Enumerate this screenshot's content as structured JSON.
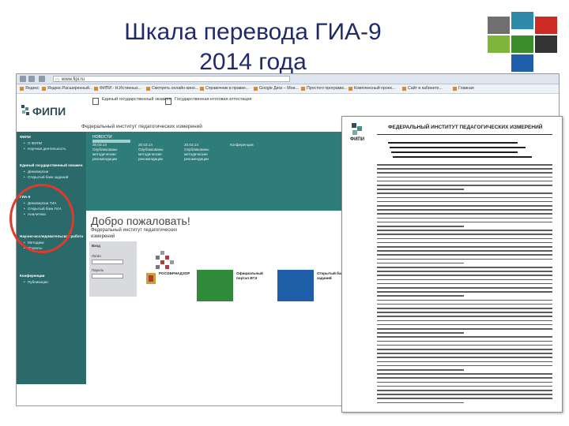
{
  "slide": {
    "title_line1": "Шкала перевода ГИА-9",
    "title_line2": "2014 года"
  },
  "browser": {
    "url": "www.fipi.ru",
    "bookmarks": [
      "Яндекс",
      "Яндекс.Расширенный...",
      "ФИПИ - Н.Истинных...",
      "Смотреть онлайн-кино...",
      "Справочник в правке...",
      "Google Диск – Мои...",
      "Простого программ...",
      "Комплексный проек...",
      "Сайт в кабинете...",
      "Главная"
    ]
  },
  "site": {
    "logo": "ФИПИ",
    "subtitle": "Федеральный институт педагогических измерений",
    "header_link1": "Единый государственный экзамен",
    "header_link2": "Государственная итоговая аттестация",
    "welcome": "Добро пожаловать!",
    "welcome_sub": "Федеральный институт педагогических измерений",
    "news_tab": "НОВОСТИ",
    "news": [
      {
        "date": "20.03.14",
        "text": "Опубликованы методические рекомендации"
      },
      {
        "date": "20.03.14",
        "text": "Опубликованы методические рекомендации"
      },
      {
        "date": "20.03.14",
        "text": "Опубликованы методические рекомендации"
      },
      {
        "date": "",
        "text": "Конференции"
      }
    ],
    "login_label": "Вход",
    "login_field1": "Логин",
    "login_field2": "Пароль",
    "cards": [
      {
        "label": "РОСОБРНАДЗОР"
      },
      {
        "label": "Официальный портал ЕГЭ"
      },
      {
        "label": "Открытый банк заданий"
      }
    ]
  },
  "leftnav": {
    "items": [
      {
        "text": "ФИПИ",
        "head": true
      },
      {
        "text": "О ФИПИ",
        "head": false
      },
      {
        "text": "Научная деятельность",
        "head": false
      },
      {
        "text": "Единый государственный экзамен",
        "head": true
      },
      {
        "text": "Демоверсии",
        "head": false
      },
      {
        "text": "Открытый банк заданий",
        "head": false
      },
      {
        "text": "ГИА-9",
        "head": true
      },
      {
        "text": "Демоверсии ГИА",
        "head": false
      },
      {
        "text": "Открытый банк ГИА",
        "head": false
      },
      {
        "text": "Аналитика",
        "head": false
      },
      {
        "text": "Научно-исследовательская работа",
        "head": true
      },
      {
        "text": "Методики",
        "head": false
      },
      {
        "text": "Проекты",
        "head": false
      },
      {
        "text": "Конференции",
        "head": true
      },
      {
        "text": "Публикации",
        "head": false
      }
    ]
  },
  "doc": {
    "org": "ФЕДЕРАЛЬНЫЙ ИНСТИТУТ ПЕДАГОГИЧЕСКИХ ИЗМЕРЕНИЙ",
    "logo": "ФИПИ"
  },
  "colors": {
    "title": "#1f2a6b",
    "teal": "#2f7d7b",
    "annotation": "#e03a2b"
  }
}
